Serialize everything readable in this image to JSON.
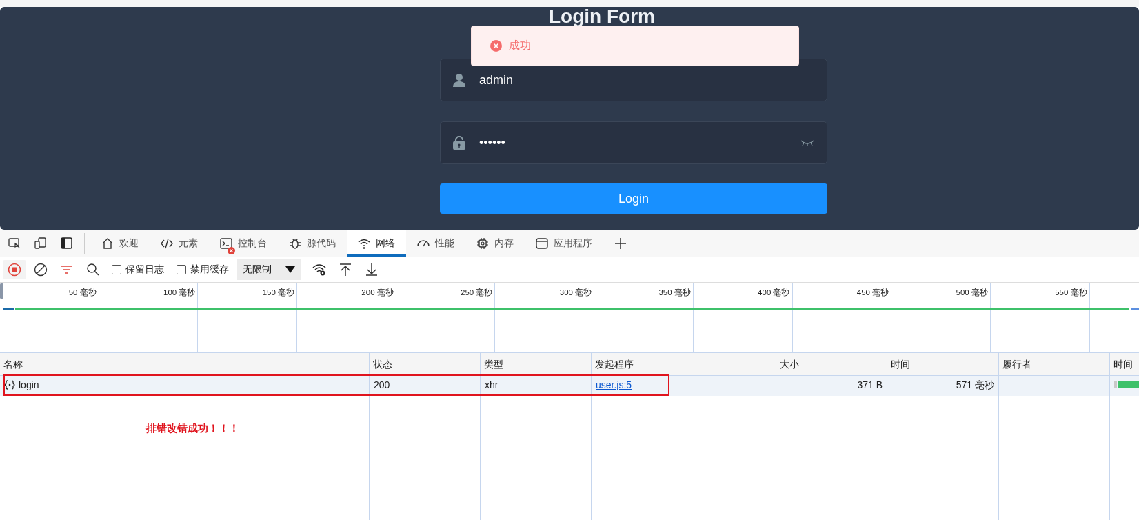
{
  "app": {
    "title": "Login Form",
    "toast": {
      "kind": "error",
      "message": "成功"
    },
    "username": {
      "value": "admin"
    },
    "password": {
      "value": "••••••"
    },
    "login_button": "Login"
  },
  "devtools": {
    "tabs": [
      {
        "label": "欢迎",
        "selected": false
      },
      {
        "label": "元素",
        "selected": false
      },
      {
        "label": "控制台",
        "selected": false
      },
      {
        "label": "源代码",
        "selected": false
      },
      {
        "label": "网络",
        "selected": true
      },
      {
        "label": "性能",
        "selected": false
      },
      {
        "label": "内存",
        "selected": false
      },
      {
        "label": "应用程序",
        "selected": false
      }
    ],
    "toolbar": {
      "preserve_log": {
        "label": "保留日志",
        "checked": false
      },
      "disable_cache": {
        "label": "禁用缓存",
        "checked": false
      },
      "throttling": "无限制"
    },
    "timeline": {
      "ticks": [
        "50 毫秒",
        "100 毫秒",
        "150 毫秒",
        "200 毫秒",
        "250 毫秒",
        "300 毫秒",
        "350 毫秒",
        "400 毫秒",
        "450 毫秒",
        "500 毫秒",
        "550 毫秒"
      ]
    },
    "table": {
      "columns": [
        "名称",
        "状态",
        "类型",
        "发起程序",
        "大小",
        "时间",
        "履行者",
        "时间"
      ],
      "rows": [
        {
          "name": "login",
          "status": "200",
          "type": "xhr",
          "initiator": "user.js:5",
          "size": "371 B",
          "time": "571  毫秒",
          "highlighted": true
        }
      ]
    }
  },
  "annotation": "排错改错成功！！！"
}
